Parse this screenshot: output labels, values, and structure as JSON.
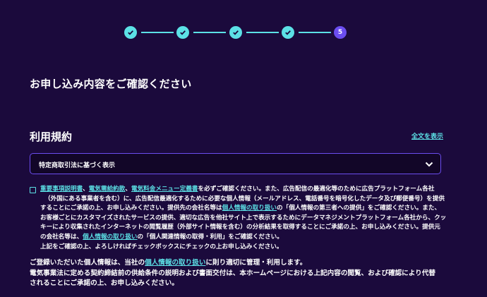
{
  "stepper": {
    "steps": [
      {
        "state": "done"
      },
      {
        "state": "done"
      },
      {
        "state": "done"
      },
      {
        "state": "done"
      },
      {
        "state": "active",
        "label": "5"
      }
    ],
    "colors": {
      "done": "#5ce1e6",
      "active": "#6b4df0"
    }
  },
  "page": {
    "title": "お申し込み内容をご確認ください"
  },
  "terms": {
    "heading": "利用規約",
    "show_all": "全文を表示",
    "select_label": "特定商取引法に基づく表示"
  },
  "consent": {
    "l1_link1": "重要事項説明書",
    "l1_sep1": "、",
    "l1_link2": "電気需給約款",
    "l1_sep2": "、",
    "l1_link3": "電気料金メニュー定義書",
    "l1_text": "を必ずご確認ください。また、広告配信の最適化等のために広告プラットフォーム各社",
    "l2": "（外国にある事業者を含む）に、広告配信最適化するために必要な個人情報（メールアドレス、電話番号を暗号化したデータ及び郵便番号）を提供",
    "l3_pre": "することにご承諾の上、お申し込みください。提供先の会社名等は",
    "l3_link": "個人情報の取り扱い",
    "l3_post": "の「個人情報の第三者への提供」をご確認ください。また、",
    "l4": "お客様ごとにカスタマイズされたサービスの提供、適切な広告を他社サイト上で表示するためにデータマネジメントプラットフォーム各社から、クッ",
    "l5": "キーにより収集されたインターネットの閲覧履歴（外部サイト情報を含む）の分析結果を取得することにご承諾の上、お申し込みください。提供元",
    "l6_pre": "の会社名等は、",
    "l6_link": "個人情報の取り扱い",
    "l6_post": "の「個人関連情報の取得・利用」をご確認ください。",
    "l7": "上記をご確認の上、よろしければチェックボックスにチェックの上お申し込みください。"
  },
  "note": {
    "l1_pre": "ご登録いただいた個人情報は、当社の",
    "l1_link": "個人情報の取り扱い",
    "l1_post": "に則り適切に管理・利用します。",
    "l2": "電気事業法に定める契約締結前の供給条件の説明および書面交付は、本ホームページにおける上記内容の閲覧、および確認により代替",
    "l3": "されることにご承諾の上、お申し込みください。"
  }
}
